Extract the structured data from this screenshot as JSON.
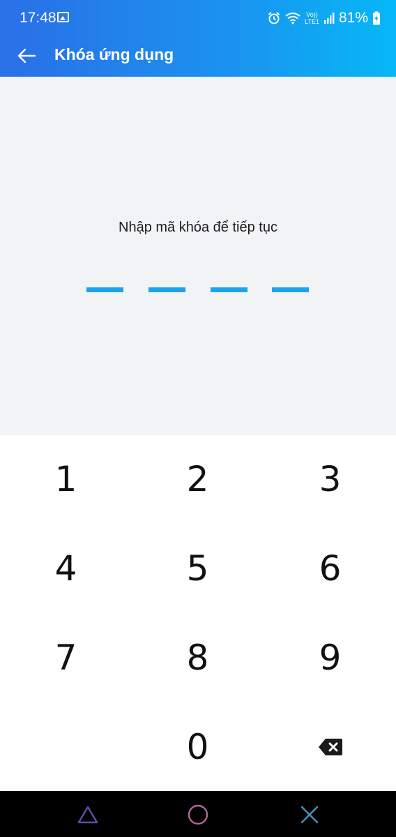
{
  "status_bar": {
    "time": "17:48",
    "network_label_top": "Vo))",
    "network_label_bottom": "LTE1",
    "battery": "81%",
    "icons": [
      "gallery-icon",
      "alarm-icon",
      "wifi-icon",
      "signal-icon",
      "battery-charging-icon"
    ]
  },
  "app_bar": {
    "title": "Khóa ứng dụng",
    "back_icon": "arrow-left-icon"
  },
  "lock_screen": {
    "prompt": "Nhập mã khóa để tiếp tục",
    "pin_length": 4,
    "pin_color": "#1ba3ec"
  },
  "keypad": {
    "keys": [
      "1",
      "2",
      "3",
      "4",
      "5",
      "6",
      "7",
      "8",
      "9",
      "",
      "0"
    ],
    "backspace_icon": "backspace-icon"
  },
  "nav_bar": {
    "buttons": [
      "recents-triangle-icon",
      "home-circle-icon",
      "back-x-icon"
    ]
  },
  "colors": {
    "header_gradient_start": "#2a6fe6",
    "header_gradient_end": "#06b8f5",
    "content_background": "#f2f3f5",
    "keypad_background": "#ffffff"
  }
}
